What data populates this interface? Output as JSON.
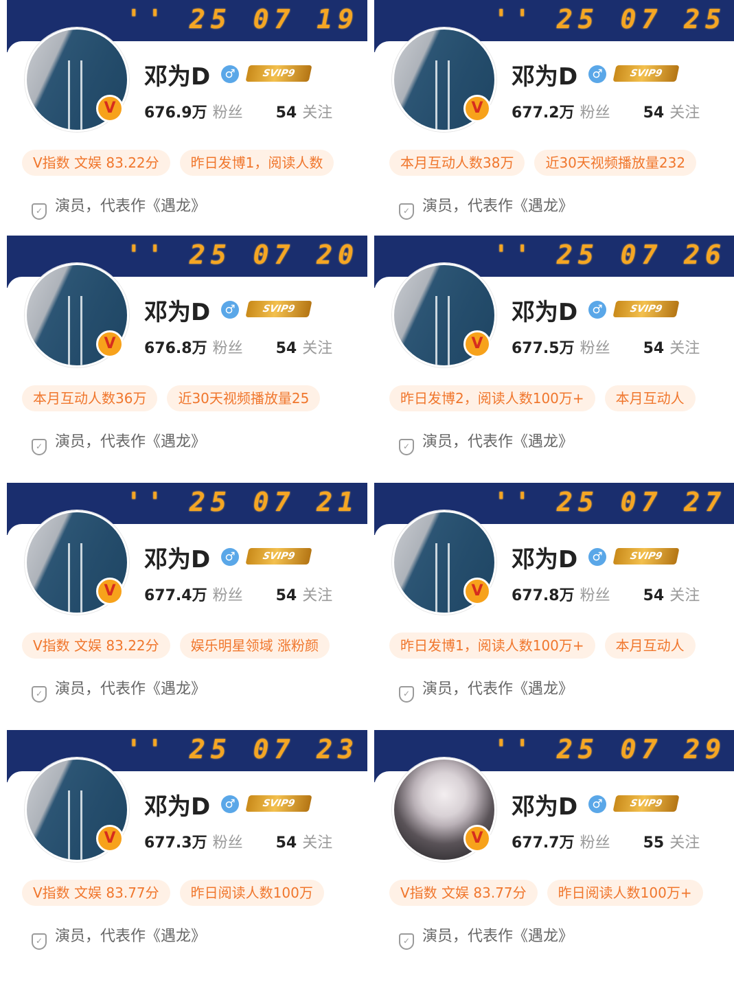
{
  "cards": [
    {
      "date": "'' 25 07 19",
      "name": "邓为D",
      "svip": "SVIP9",
      "fans_count": "676.9万",
      "fans_label": "粉丝",
      "follow_count": "54",
      "follow_label": "关注",
      "tags": [
        "V指数 文娱 83.22分",
        "昨日发博1，阅读人数"
      ],
      "description": "演员，代表作《遇龙》"
    },
    {
      "date": "'' 25 07 25",
      "name": "邓为D",
      "svip": "SVIP9",
      "fans_count": "677.2万",
      "fans_label": "粉丝",
      "follow_count": "54",
      "follow_label": "关注",
      "tags": [
        "本月互动人数38万",
        "近30天视频播放量232"
      ],
      "description": "演员，代表作《遇龙》"
    },
    {
      "date": "'' 25 07 20",
      "name": "邓为D",
      "svip": "SVIP9",
      "fans_count": "676.8万",
      "fans_label": "粉丝",
      "follow_count": "54",
      "follow_label": "关注",
      "tags": [
        "本月互动人数36万",
        "近30天视频播放量25"
      ],
      "description": "演员，代表作《遇龙》"
    },
    {
      "date": "'' 25 07 26",
      "name": "邓为D",
      "svip": "SVIP9",
      "fans_count": "677.5万",
      "fans_label": "粉丝",
      "follow_count": "54",
      "follow_label": "关注",
      "tags": [
        "昨日发博2，阅读人数100万+",
        "本月互动人"
      ],
      "description": "演员，代表作《遇龙》"
    },
    {
      "date": "'' 25 07 21",
      "name": "邓为D",
      "svip": "SVIP9",
      "fans_count": "677.4万",
      "fans_label": "粉丝",
      "follow_count": "54",
      "follow_label": "关注",
      "tags": [
        "V指数 文娱 83.22分",
        "娱乐明星领域 涨粉颜"
      ],
      "description": "演员，代表作《遇龙》"
    },
    {
      "date": "'' 25 07 27",
      "name": "邓为D",
      "svip": "SVIP9",
      "fans_count": "677.8万",
      "fans_label": "粉丝",
      "follow_count": "54",
      "follow_label": "关注",
      "tags": [
        "昨日发博1，阅读人数100万+",
        "本月互动人"
      ],
      "description": "演员，代表作《遇龙》"
    },
    {
      "date": "'' 25 07 23",
      "name": "邓为D",
      "svip": "SVIP9",
      "fans_count": "677.3万",
      "fans_label": "粉丝",
      "follow_count": "54",
      "follow_label": "关注",
      "tags": [
        "V指数 文娱 83.77分",
        "昨日阅读人数100万"
      ],
      "description": "演员，代表作《遇龙》"
    },
    {
      "date": "'' 25 07 29",
      "name": "邓为D",
      "svip": "SVIP9",
      "fans_count": "677.7万",
      "fans_label": "粉丝",
      "follow_count": "55",
      "follow_label": "关注",
      "tags": [
        "V指数 文娱 83.77分",
        "昨日阅读人数100万+"
      ],
      "description": "演员，代表作《遇龙》"
    }
  ],
  "colors": {
    "banner": "#1a2e6e",
    "date_digits": "#f5a623",
    "tag_bg": "#fff1e6",
    "tag_text": "#f0762c",
    "verified_badge": "#f7a21b",
    "gender_badge": "#5aa7e8"
  }
}
